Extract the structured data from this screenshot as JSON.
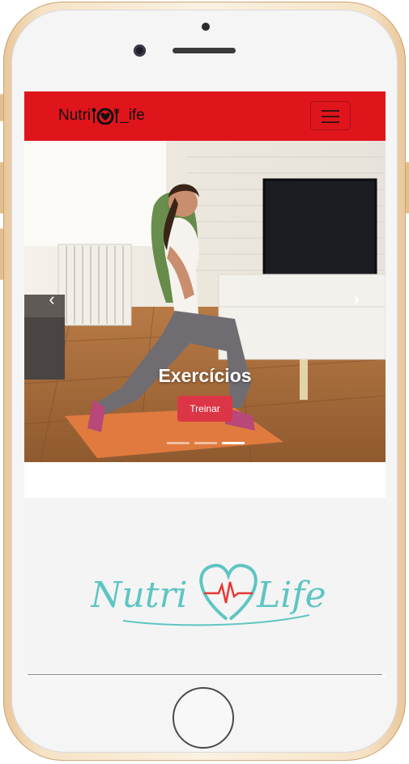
{
  "brand": {
    "prefix": "Nutri",
    "suffix": "_ife"
  },
  "carousel": {
    "caption_title": "Exercícios",
    "button_label": "Treinar",
    "slide_count": 3,
    "active_slide": 3
  },
  "logo": {
    "text_left": "Nutri",
    "text_right": "Life"
  },
  "colors": {
    "navbar": "#e0151c",
    "button": "#dc3545",
    "logo_teal": "#5ec5c2",
    "logo_heart": "#e53935"
  },
  "icons": {
    "menu": "hamburger-icon",
    "prev": "chevron-left-icon",
    "next": "chevron-right-icon"
  }
}
